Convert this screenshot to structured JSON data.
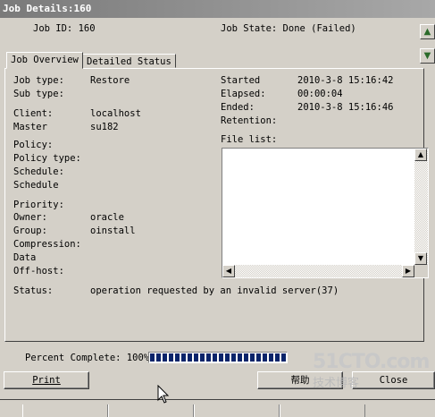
{
  "window": {
    "title": "Job Details:160"
  },
  "header": {
    "job_id_label": "Job ID:",
    "job_id_value": "160",
    "job_state_label": "Job State:",
    "job_state_value": "Done (Failed)"
  },
  "tabs": [
    {
      "label": "Job Overview",
      "active": true
    },
    {
      "label": "Detailed Status",
      "active": false
    }
  ],
  "left_fields": [
    {
      "label": "Job type:",
      "value": "Restore"
    },
    {
      "label": "Sub type:",
      "value": ""
    },
    {
      "label": "Client:",
      "value": "localhost"
    },
    {
      "label": "Master",
      "value": "su182"
    },
    {
      "label": "Policy:",
      "value": ""
    },
    {
      "label": "Policy type:",
      "value": ""
    },
    {
      "label": "Schedule:",
      "value": ""
    },
    {
      "label": "Schedule",
      "value": ""
    },
    {
      "label": "Priority:",
      "value": ""
    },
    {
      "label": "Owner:",
      "value": "oracle"
    },
    {
      "label": "Group:",
      "value": "oinstall"
    },
    {
      "label": "Compression:",
      "value": ""
    },
    {
      "label": "Data",
      "value": ""
    },
    {
      "label": "Off-host:",
      "value": ""
    }
  ],
  "right_fields": [
    {
      "label": "Started",
      "value": "2010-3-8 15:16:42"
    },
    {
      "label": "Elapsed:",
      "value": "00:00:04"
    },
    {
      "label": "Ended:",
      "value": "2010-3-8 15:16:46"
    },
    {
      "label": "Retention:",
      "value": ""
    }
  ],
  "file_list": {
    "label": "File list:",
    "items": []
  },
  "status": {
    "label": "Status:",
    "value": "operation requested by an invalid server(37)"
  },
  "progress": {
    "label": "Percent Complete:",
    "percent_text": "100%",
    "fraction": 1.0
  },
  "buttons": {
    "print": "Print",
    "help": "帮助",
    "close": "Close"
  },
  "watermark": {
    "line1": "51CTO.com",
    "line2": "技术博客"
  },
  "icons": {
    "up": "up-arrow-icon",
    "down": "down-arrow-icon"
  }
}
